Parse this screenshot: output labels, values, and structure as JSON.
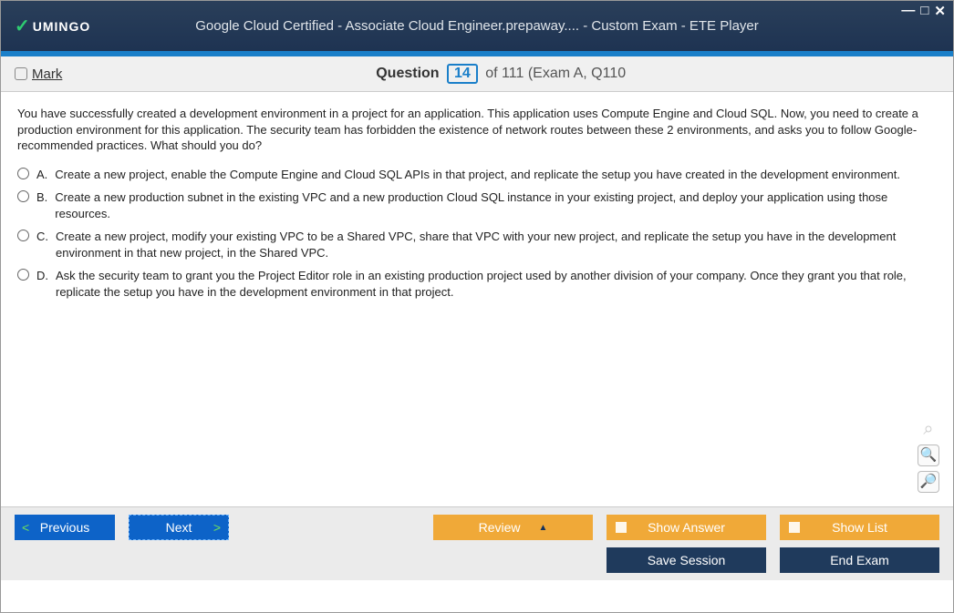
{
  "titlebar": {
    "logo": "UMINGO",
    "title": "Google Cloud Certified - Associate Cloud Engineer.prepaway.... - Custom Exam - ETE Player"
  },
  "header": {
    "mark": "Mark",
    "question_label": "Question",
    "current": "14",
    "rest": "of 111 (Exam A, Q110"
  },
  "question": {
    "text": "You have successfully created a development environment in a project for an application. This application uses Compute Engine and Cloud SQL. Now, you need to create a production environment for this application. The security team has forbidden the existence of network routes between these 2 environments, and asks you to follow Google-recommended practices. What should you do?",
    "options": [
      {
        "letter": "A.",
        "text": "Create a new project, enable the Compute Engine and Cloud SQL APIs in that project, and replicate the setup you have created in the development environment."
      },
      {
        "letter": "B.",
        "text": "Create a new production subnet in the existing VPC and a new production Cloud SQL instance in your existing project, and deploy your application using those resources."
      },
      {
        "letter": "C.",
        "text": "Create a new project, modify your existing VPC to be a Shared VPC, share that VPC with your new project, and replicate the setup you have in the development environment in that new project, in the Shared VPC."
      },
      {
        "letter": "D.",
        "text": "Ask the security team to grant you the Project Editor role in an existing production project used by another division of your company. Once they grant you that role, replicate the setup you have in the development environment in that project."
      }
    ]
  },
  "footer": {
    "previous": "Previous",
    "next": "Next",
    "review": "Review",
    "show_answer": "Show Answer",
    "show_list": "Show List",
    "save_session": "Save Session",
    "end_exam": "End Exam"
  }
}
